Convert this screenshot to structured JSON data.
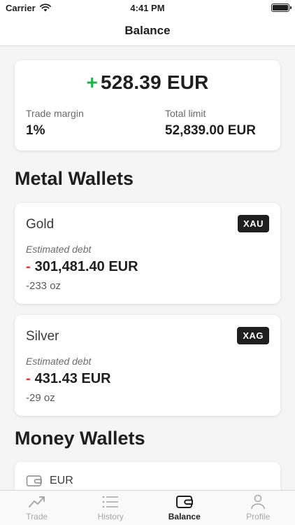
{
  "status_bar": {
    "carrier": "Carrier",
    "time": "4:41 PM"
  },
  "nav": {
    "title": "Balance"
  },
  "balance": {
    "sign": "+",
    "amount": "528.39 EUR",
    "trade_margin_label": "Trade margin",
    "trade_margin_value": "1%",
    "total_limit_label": "Total limit",
    "total_limit_value": "52,839.00 EUR"
  },
  "sections": {
    "metal_title": "Metal Wallets",
    "money_title": "Money Wallets"
  },
  "metal_wallets": [
    {
      "name": "Gold",
      "code": "XAU",
      "debt_label": "Estimated debt",
      "sign": "-",
      "debt_amount": "301,481.40 EUR",
      "oz": "-233 oz"
    },
    {
      "name": "Silver",
      "code": "XAG",
      "debt_label": "Estimated debt",
      "sign": "-",
      "debt_amount": "431.43 EUR",
      "oz": "-29 oz"
    }
  ],
  "money_wallets": [
    {
      "name": "EUR",
      "icon": "wallet-icon"
    }
  ],
  "tabs": [
    {
      "label": "Trade",
      "icon": "trend-icon",
      "active": false
    },
    {
      "label": "History",
      "icon": "list-icon",
      "active": false
    },
    {
      "label": "Balance",
      "icon": "wallet-icon",
      "active": true
    },
    {
      "label": "Profile",
      "icon": "person-icon",
      "active": false
    }
  ],
  "colors": {
    "positive": "#1fb14a",
    "negative": "#e03b3b",
    "badge": "#1f1f1f",
    "background": "#f5f5f5"
  }
}
